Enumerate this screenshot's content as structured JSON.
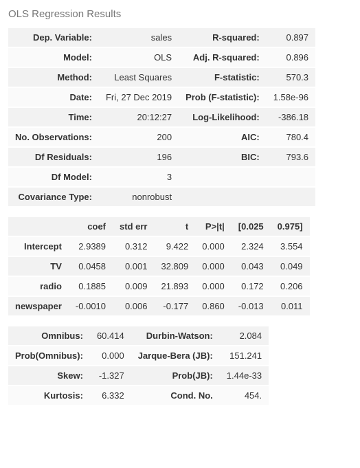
{
  "title": "OLS Regression Results",
  "summary": {
    "rows": [
      {
        "l1": "Dep. Variable:",
        "v1": "sales",
        "l2": "R-squared:",
        "v2": "0.897"
      },
      {
        "l1": "Model:",
        "v1": "OLS",
        "l2": "Adj. R-squared:",
        "v2": "0.896"
      },
      {
        "l1": "Method:",
        "v1": "Least Squares",
        "l2": "F-statistic:",
        "v2": "570.3"
      },
      {
        "l1": "Date:",
        "v1": "Fri, 27 Dec 2019",
        "l2": "Prob (F-statistic):",
        "v2": "1.58e-96"
      },
      {
        "l1": "Time:",
        "v1": "20:12:27",
        "l2": "Log-Likelihood:",
        "v2": "-386.18"
      },
      {
        "l1": "No. Observations:",
        "v1": "200",
        "l2": "AIC:",
        "v2": "780.4"
      },
      {
        "l1": "Df Residuals:",
        "v1": "196",
        "l2": "BIC:",
        "v2": "793.6"
      },
      {
        "l1": "Df Model:",
        "v1": "3",
        "l2": "",
        "v2": ""
      },
      {
        "l1": "Covariance Type:",
        "v1": "nonrobust",
        "l2": "",
        "v2": ""
      }
    ]
  },
  "coef": {
    "headers": [
      "",
      "coef",
      "std err",
      "t",
      "P>|t|",
      "[0.025",
      "0.975]"
    ],
    "rows": [
      {
        "name": "Intercept",
        "coef": "2.9389",
        "se": "0.312",
        "t": "9.422",
        "p": "0.000",
        "lo": "2.324",
        "hi": "3.554"
      },
      {
        "name": "TV",
        "coef": "0.0458",
        "se": "0.001",
        "t": "32.809",
        "p": "0.000",
        "lo": "0.043",
        "hi": "0.049"
      },
      {
        "name": "radio",
        "coef": "0.1885",
        "se": "0.009",
        "t": "21.893",
        "p": "0.000",
        "lo": "0.172",
        "hi": "0.206"
      },
      {
        "name": "newspaper",
        "coef": "-0.0010",
        "se": "0.006",
        "t": "-0.177",
        "p": "0.860",
        "lo": "-0.013",
        "hi": "0.011"
      }
    ]
  },
  "diag": {
    "rows": [
      {
        "l1": "Omnibus:",
        "v1": "60.414",
        "l2": "Durbin-Watson:",
        "v2": "2.084"
      },
      {
        "l1": "Prob(Omnibus):",
        "v1": "0.000",
        "l2": "Jarque-Bera (JB):",
        "v2": "151.241"
      },
      {
        "l1": "Skew:",
        "v1": "-1.327",
        "l2": "Prob(JB):",
        "v2": "1.44e-33"
      },
      {
        "l1": "Kurtosis:",
        "v1": "6.332",
        "l2": "Cond. No.",
        "v2": "454."
      }
    ]
  },
  "chart_data": {
    "type": "table",
    "title": "OLS Regression Results",
    "dependent_variable": "sales",
    "r_squared": 0.897,
    "adj_r_squared": 0.896,
    "f_statistic": 570.3,
    "prob_f_statistic": 1.58e-96,
    "log_likelihood": -386.18,
    "n_observations": 200,
    "df_residuals": 196,
    "df_model": 3,
    "aic": 780.4,
    "bic": 793.6,
    "covariance_type": "nonrobust",
    "coefficients": [
      {
        "term": "Intercept",
        "coef": 2.9389,
        "std_err": 0.312,
        "t": 9.422,
        "p": 0.0,
        "ci_low": 2.324,
        "ci_high": 3.554
      },
      {
        "term": "TV",
        "coef": 0.0458,
        "std_err": 0.001,
        "t": 32.809,
        "p": 0.0,
        "ci_low": 0.043,
        "ci_high": 0.049
      },
      {
        "term": "radio",
        "coef": 0.1885,
        "std_err": 0.009,
        "t": 21.893,
        "p": 0.0,
        "ci_low": 0.172,
        "ci_high": 0.206
      },
      {
        "term": "newspaper",
        "coef": -0.001,
        "std_err": 0.006,
        "t": -0.177,
        "p": 0.86,
        "ci_low": -0.013,
        "ci_high": 0.011
      }
    ],
    "diagnostics": {
      "omnibus": 60.414,
      "prob_omnibus": 0.0,
      "durbin_watson": 2.084,
      "jarque_bera": 151.241,
      "skew": -1.327,
      "prob_jb": 1.44e-33,
      "kurtosis": 6.332,
      "cond_no": 454.0
    }
  }
}
